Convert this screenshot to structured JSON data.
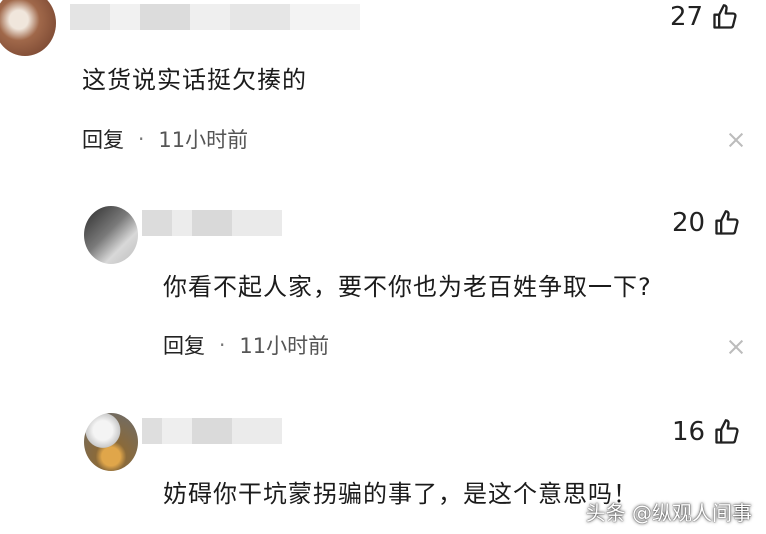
{
  "comments": [
    {
      "likes": "27",
      "text": "这货说实话挺欠揍的",
      "reply_label": "回复",
      "separator": "·",
      "time": "11小时前"
    },
    {
      "likes": "20",
      "text": "你看不起人家，要不你也为老百姓争取一下?",
      "reply_label": "回复",
      "separator": "·",
      "time": "11小时前"
    },
    {
      "likes": "16",
      "text": "妨碍你干坑蒙拐骗的事了，是这个意思吗！"
    }
  ],
  "watermark": "头条 @纵观人间事",
  "icons": {
    "like": "thumbs-up-icon",
    "dismiss": "close-icon"
  }
}
